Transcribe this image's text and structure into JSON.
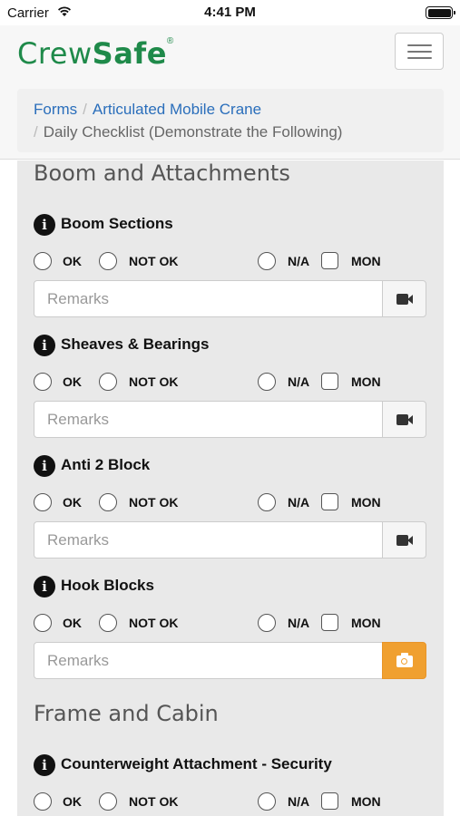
{
  "status_bar": {
    "carrier": "Carrier",
    "time": "4:41 PM"
  },
  "logo": {
    "part1": "Crew",
    "part2": "Safe",
    "reg": "®"
  },
  "breadcrumb": {
    "item1": "Forms",
    "item2": "Articulated Mobile Crane",
    "active": "Daily Checklist (Demonstrate the Following)",
    "separator": "/"
  },
  "options": {
    "ok": "OK",
    "not_ok": "NOT OK",
    "na": "N/A",
    "mon": "MON"
  },
  "remarks_placeholder": "Remarks",
  "info_glyph": "i",
  "sections": [
    {
      "title": "Boom and Attachments",
      "items": [
        {
          "label": "Boom Sections",
          "media": "video"
        },
        {
          "label": "Sheaves & Bearings",
          "media": "video"
        },
        {
          "label": "Anti 2 Block",
          "media": "video"
        },
        {
          "label": "Hook Blocks",
          "media": "photo"
        }
      ]
    },
    {
      "title": "Frame and Cabin",
      "items": [
        {
          "label": "Counterweight Attachment - Security"
        }
      ]
    }
  ],
  "colors": {
    "brand_green": "#1f8a4a",
    "link_blue": "#2a6ebb",
    "photo_orange": "#f0a030"
  }
}
